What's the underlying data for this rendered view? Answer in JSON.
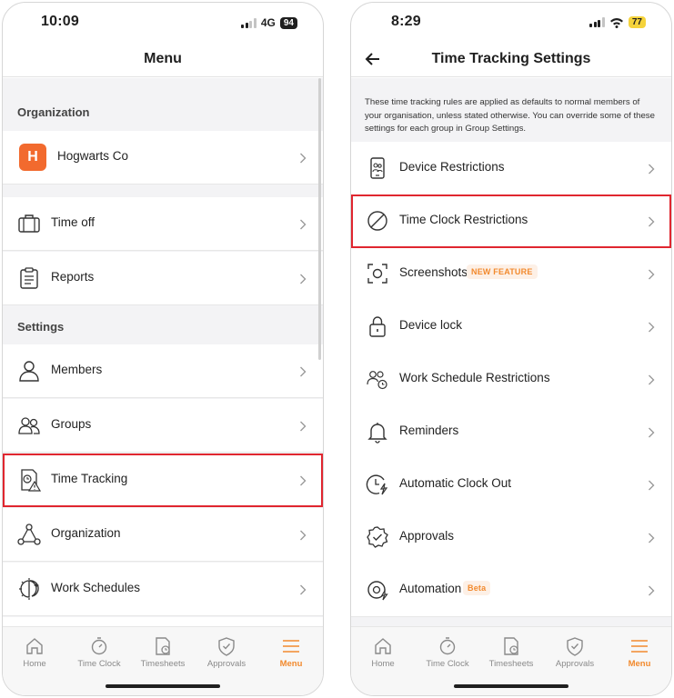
{
  "left": {
    "status": {
      "time": "10:09",
      "network": "4G",
      "battery": "94"
    },
    "title": "Menu",
    "sections": {
      "organization": "Organization",
      "settings": "Settings"
    },
    "org_badge": "H",
    "items": {
      "org_name": "Hogwarts Co",
      "time_off": "Time off",
      "reports": "Reports",
      "members": "Members",
      "groups": "Groups",
      "time_tracking": "Time Tracking",
      "organization": "Organization",
      "work_schedules": "Work Schedules"
    },
    "icons": [
      "suitcase-icon",
      "clipboard-icon",
      "person-icon",
      "people-icon",
      "time-tracking-icon",
      "organization-nodes-icon",
      "sun-moon-icon"
    ]
  },
  "right": {
    "status": {
      "time": "8:29",
      "battery": "77"
    },
    "title": "Time Tracking Settings",
    "info": "These time tracking rules are applied as defaults to normal members of your organisation, unless stated otherwise. You can override some of these settings for each group in Group Settings.",
    "items": {
      "device_restrictions": "Device Restrictions",
      "time_clock_restrictions": "Time Clock Restrictions",
      "screenshots": "Screenshots",
      "screenshots_badge": "NEW FEATURE",
      "device_lock": "Device lock",
      "work_schedule_restrictions": "Work Schedule Restrictions",
      "reminders": "Reminders",
      "automatic_clock_out": "Automatic Clock Out",
      "approvals": "Approvals",
      "automation": "Automation",
      "automation_badge": "Beta"
    }
  },
  "tabs": {
    "home": "Home",
    "time_clock": "Time Clock",
    "timesheets": "Timesheets",
    "approvals": "Approvals",
    "menu": "Menu"
  },
  "colors": {
    "accent": "#f28a2e",
    "highlight": "#e0262f",
    "org_badge": "#f26a2e"
  }
}
